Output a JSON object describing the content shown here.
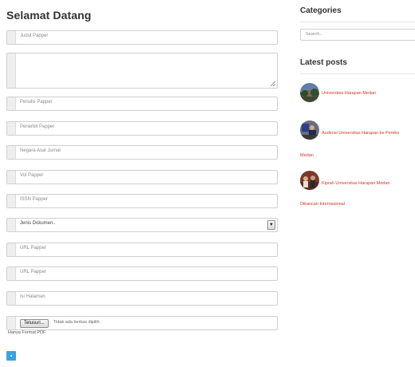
{
  "form": {
    "heading": "Selamat Datang",
    "fields": {
      "judul": {
        "placeholder": "Judul Papper"
      },
      "abstract": {
        "placeholder": ""
      },
      "penulis": {
        "placeholder": "Penulis Papper"
      },
      "penerbit": {
        "placeholder": "Penerbit Papper"
      },
      "negara": {
        "placeholder": "Negara Asal Jurnal"
      },
      "vol": {
        "placeholder": "Vol Papper"
      },
      "issn": {
        "placeholder": "ISSN Papper"
      },
      "jenis": {
        "selected": "Jenis Dokumen..",
        "arrow_icon": "chevron-down-icon"
      },
      "url1": {
        "placeholder": "URL Papper"
      },
      "url2": {
        "placeholder": "URL Papper"
      },
      "isi": {
        "placeholder": "Isi Halaman"
      }
    },
    "file_input": {
      "browse_label": "Telusuri...",
      "status": "Tidak ada berkas dipilih."
    },
    "file_note": "Hanya Format PDF",
    "submit": {
      "color": "#3aa3dc"
    }
  },
  "sidebar": {
    "categories": {
      "title": "Categories",
      "search_placeholder": "Search.."
    },
    "latest_posts": {
      "title": "Latest posts",
      "link_color": "#d9342b",
      "posts": [
        {
          "line1": "Universitas Harapan Medan",
          "line2": ""
        },
        {
          "line1": "Audensi Universitas Harapan ke Pemko",
          "line2": "Medan"
        },
        {
          "line1": "Kiprah Universitas Harapan Medan",
          "line2": "Dikancah Internasional"
        }
      ]
    }
  }
}
